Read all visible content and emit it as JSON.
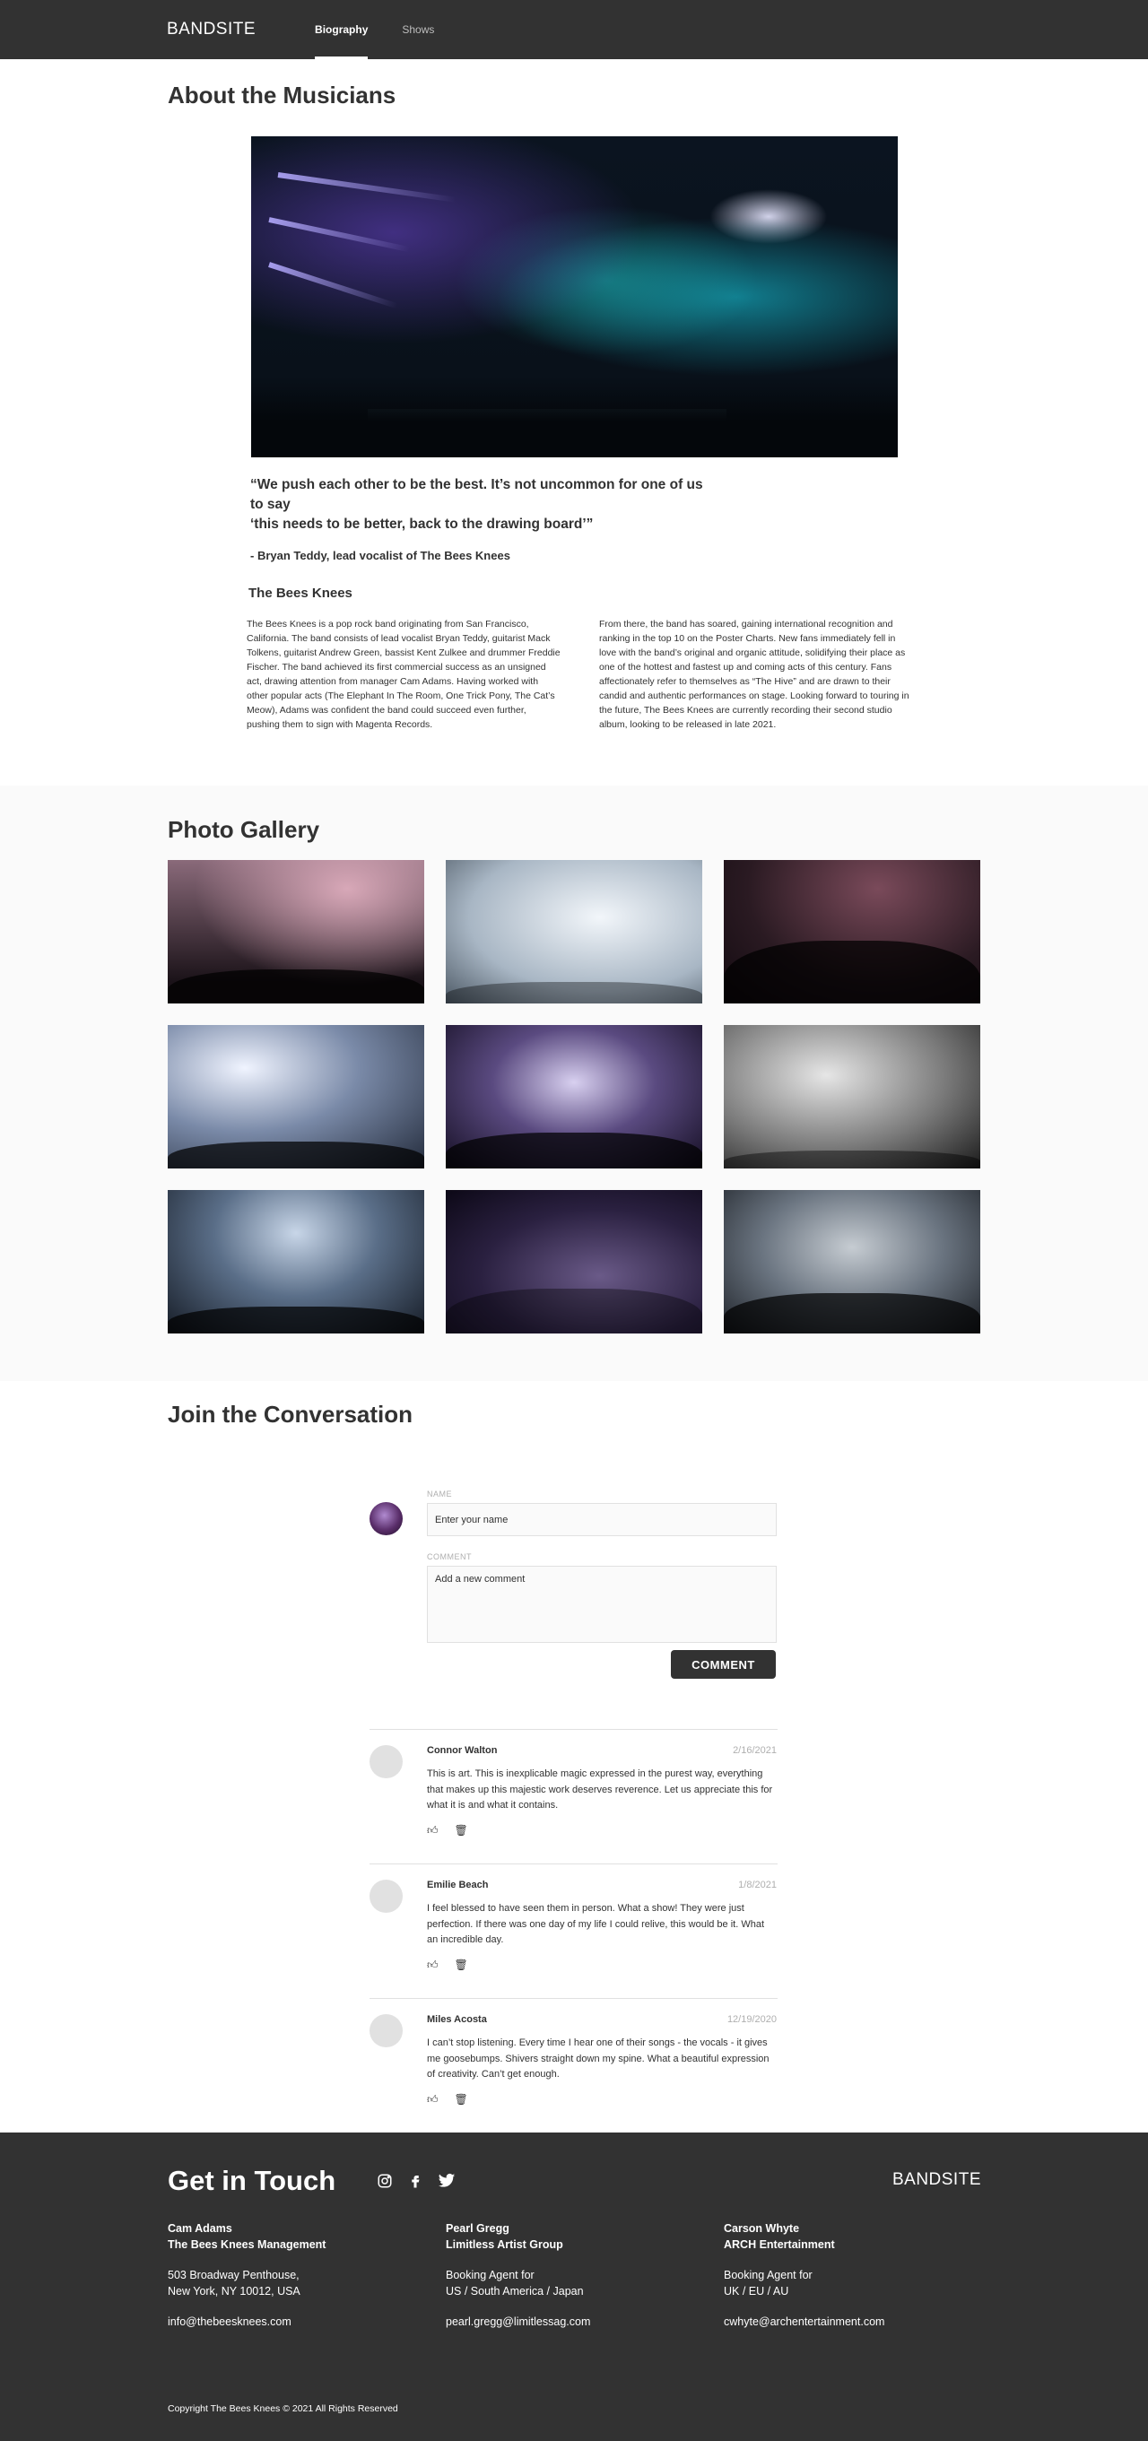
{
  "header": {
    "logo": "BANDSITE",
    "nav": [
      "Biography",
      "Shows"
    ]
  },
  "bio": {
    "title": "About the Musicians",
    "quote_line1": "“We push each other to be the best. It’s not uncommon for one of us to say",
    "quote_line2": "‘this needs to be better, back to the drawing board’”",
    "quote_author": "- Bryan Teddy, lead vocalist of The Bees Knees",
    "band_name": "The Bees Knees",
    "col1": "The Bees Knees is a pop rock band originating from San Francisco, California. The band consists of lead vocalist Bryan Teddy, guitarist Mack Tolkens, guitarist Andrew Green, bassist Kent Zulkee and drummer Freddie Fischer. The band achieved its first commercial success as an unsigned act, drawing attention from manager Cam Adams. Having worked with other popular acts (The Elephant In The Room, One Trick Pony, The Cat’s Meow), Adams was confident the band could succeed even further, pushing them to sign with Magenta Records.",
    "col2": "From there, the band has soared, gaining international recognition and ranking in the top 10 on the Poster Charts. New fans immediately fell in love with the band’s original and organic attitude, solidifying their place as one of the hottest and fastest up and coming acts of this century. Fans affectionately refer to themselves as “The Hive” and are drawn to their candid and authentic performances on stage. Looking forward to touring in the future, The Bees Knees are currently recording their second studio album, looking to be released in late 2021."
  },
  "gallery": {
    "title": "Photo Gallery"
  },
  "conversation": {
    "title": "Join the Conversation",
    "name_label": "NAME",
    "name_placeholder": "Enter your name",
    "comment_label": "COMMENT",
    "comment_placeholder": "Add a new comment",
    "button": "COMMENT",
    "comments": [
      {
        "name": "Connor Walton",
        "date": "2/16/2021",
        "text": "This is art. This is inexplicable magic expressed in the purest way, everything that makes up this majestic work deserves reverence. Let us appreciate this for what it is and what it contains."
      },
      {
        "name": "Emilie Beach",
        "date": "1/8/2021",
        "text": "I feel blessed to have seen them in person. What a show! They were just perfection. If there was one day of my life I could relive, this would be it. What an incredible day."
      },
      {
        "name": "Miles Acosta",
        "date": "12/19/2020",
        "text": "I can’t stop listening. Every time I hear one of their songs - the vocals - it gives me goosebumps. Shivers straight down my spine. What a beautiful expression of creativity. Can’t get enough."
      }
    ]
  },
  "footer": {
    "title": "Get in Touch",
    "logo": "BANDSITE",
    "contacts": [
      {
        "name": "Cam Adams",
        "org": "The Bees Knees Management",
        "line1": "503 Broadway Penthouse,",
        "line2": "New York, NY 10012, USA",
        "email": "info@thebeesknees.com"
      },
      {
        "name": "Pearl Gregg",
        "org": "Limitless Artist Group",
        "line1": "Booking Agent for",
        "line2": "US / South America / Japan",
        "email": "pearl.gregg@limitlessag.com"
      },
      {
        "name": "Carson Whyte",
        "org": "ARCH Entertainment",
        "line1": "Booking Agent for",
        "line2": "UK / EU / AU",
        "email": "cwhyte@archentertainment.com"
      }
    ],
    "copyright": "Copyright The Bees Knees © 2021 All Rights Reserved"
  }
}
